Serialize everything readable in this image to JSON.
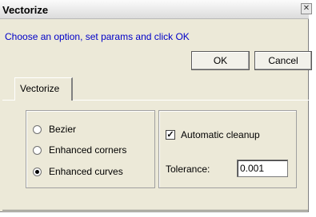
{
  "window": {
    "title": "Vectorize",
    "close_glyph": "✕"
  },
  "prompt": "Choose an option, set params and click OK",
  "buttons": {
    "ok": "OK",
    "cancel": "Cancel"
  },
  "tabs": [
    {
      "label": "Vectorize",
      "selected": true
    }
  ],
  "options": {
    "radios": [
      {
        "label": "Bezier",
        "checked": false
      },
      {
        "label": "Enhanced corners",
        "checked": false
      },
      {
        "label": "Enhanced curves",
        "checked": true
      }
    ],
    "automatic_cleanup": {
      "label": "Automatic cleanup",
      "checked": true,
      "mark": "✓"
    },
    "tolerance": {
      "label": "Tolerance:",
      "value": "0.001"
    }
  },
  "colors": {
    "prompt": "#0000c8",
    "dialog_bg": "#ece9d8"
  }
}
